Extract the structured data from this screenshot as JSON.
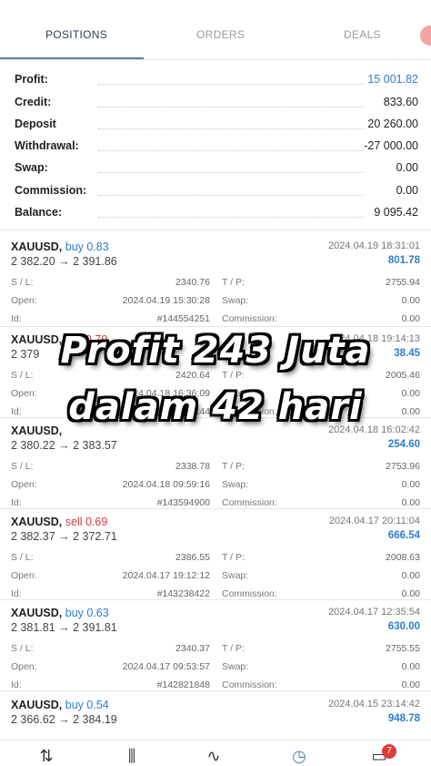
{
  "tabs": [
    {
      "label": "POSITIONS"
    },
    {
      "label": "ORDERS"
    },
    {
      "label": "DEALS"
    }
  ],
  "summary": [
    {
      "label": "Profit:",
      "value": "15 001.82"
    },
    {
      "label": "Credit:",
      "value": "833.60"
    },
    {
      "label": "Deposit",
      "value": "20 260.00"
    },
    {
      "label": "Withdrawal:",
      "value": "-27 000.00"
    },
    {
      "label": "Swap:",
      "value": "0.00"
    },
    {
      "label": "Commission:",
      "value": "0.00"
    },
    {
      "label": "Balance:",
      "value": "9 095.42"
    }
  ],
  "field_labels": {
    "sl": "S / L:",
    "tp": "T / P:",
    "open": "Open:",
    "swap": "Swap:",
    "id": "Id:",
    "commission": "Commission:"
  },
  "positions": [
    {
      "symbol": "XAUUSD,",
      "side": "buy 0.83",
      "time": "2024.04.19 18:31:01",
      "prices": "2 382.20 → 2 391.86",
      "profit": "801.78",
      "sl": "2340.76",
      "tp": "2755.94",
      "open": "2024.04.19 15:30:28",
      "swap": "0.00",
      "id": "#144554251",
      "commission": "0.00"
    },
    {
      "symbol": "XAUUSD,",
      "side": "sell 0.79",
      "time": "2024.04.18 19:14:13",
      "prices": "2 379",
      "profit": "38.45",
      "sl": "2420.64",
      "tp": "2005.46",
      "open": "2024.04.18 16:36:09",
      "swap": "0.00",
      "id": "#144",
      "commission": "0.00"
    },
    {
      "symbol": "XAUUSD,",
      "side": "",
      "time": "2024.04.18 16:02:42",
      "prices": "2 380.22 → 2 383.57",
      "profit": "254.60",
      "sl": "2338.78",
      "tp": "2753.96",
      "open": "2024.04.18 09:59:16",
      "swap": "0.00",
      "id": "#143594900",
      "commission": "0.00"
    },
    {
      "symbol": "XAUUSD,",
      "side": "sell 0.69",
      "time": "2024.04.17 20:11:04",
      "prices": "2 382.37 → 2 372.71",
      "profit": "666.54",
      "sl": "2386.55",
      "tp": "2008.63",
      "open": "2024.04.17 19:12:12",
      "swap": "0.00",
      "id": "#143238422",
      "commission": "0.00"
    },
    {
      "symbol": "XAUUSD,",
      "side": "buy 0.63",
      "time": "2024.04.17 12:35:54",
      "prices": "2 381.81 → 2 391.81",
      "profit": "630.00",
      "sl": "2340.37",
      "tp": "2755.55",
      "open": "2024.04.17 09:53:57",
      "swap": "0.00",
      "id": "#142821848",
      "commission": "0.00"
    },
    {
      "symbol": "XAUUSD,",
      "side": "buy 0.54",
      "time": "2024.04.15 23:14:42",
      "prices": "2 366.62 → 2 384.19",
      "profit": "948.78"
    }
  ],
  "overlay": {
    "line1": "Profit 243 Juta",
    "line2": "dalam 42 hari"
  },
  "bottom_nav": {
    "quotes_icon": "⇅",
    "chart_icon": "⫼",
    "trade_icon": "∿",
    "history_icon": "◷",
    "messages_icon": "▭",
    "messages_badge": "7"
  }
}
